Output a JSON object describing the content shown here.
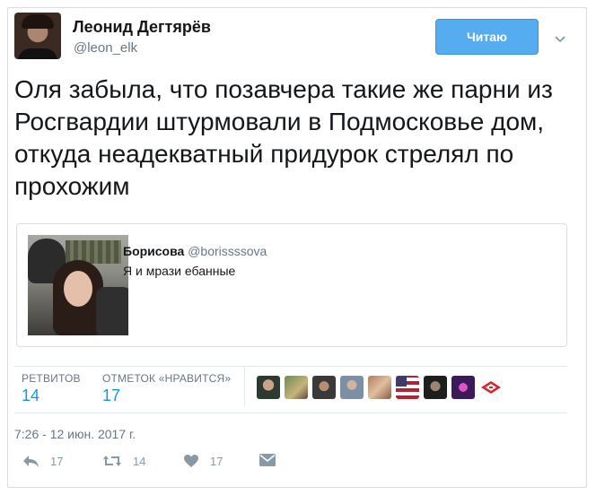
{
  "tweet": {
    "author_name": "Леонид Дегтярёв",
    "author_handle": "@leon_elk",
    "follow_label": "Читаю",
    "text": "Оля забыла, что позавчера такие же парни из Росгвардии штурмовали в Подмосковье дом, откуда неадекватный придурок стрелял по прохожим",
    "timestamp": "7:26 - 12 июн. 2017 г."
  },
  "quote": {
    "name": "Борисова",
    "handle": "@borissssova",
    "text": "Я и мрази ебанные"
  },
  "stats": {
    "retweets_label": "РЕТВИТОВ",
    "retweets_count": "14",
    "likes_label": "ОТМЕТОК «НРАВИТСЯ»",
    "likes_count": "17"
  },
  "actions": {
    "reply_count": "17",
    "retweet_count": "14",
    "like_count": "17"
  },
  "colors": {
    "accent": "#55acee",
    "link": "#1b95e0",
    "muted": "#657786",
    "icon": "#8899a6"
  },
  "icons": [
    "chevron-down-icon",
    "reply-icon",
    "retweet-icon",
    "heart-icon",
    "direct-message-icon"
  ]
}
